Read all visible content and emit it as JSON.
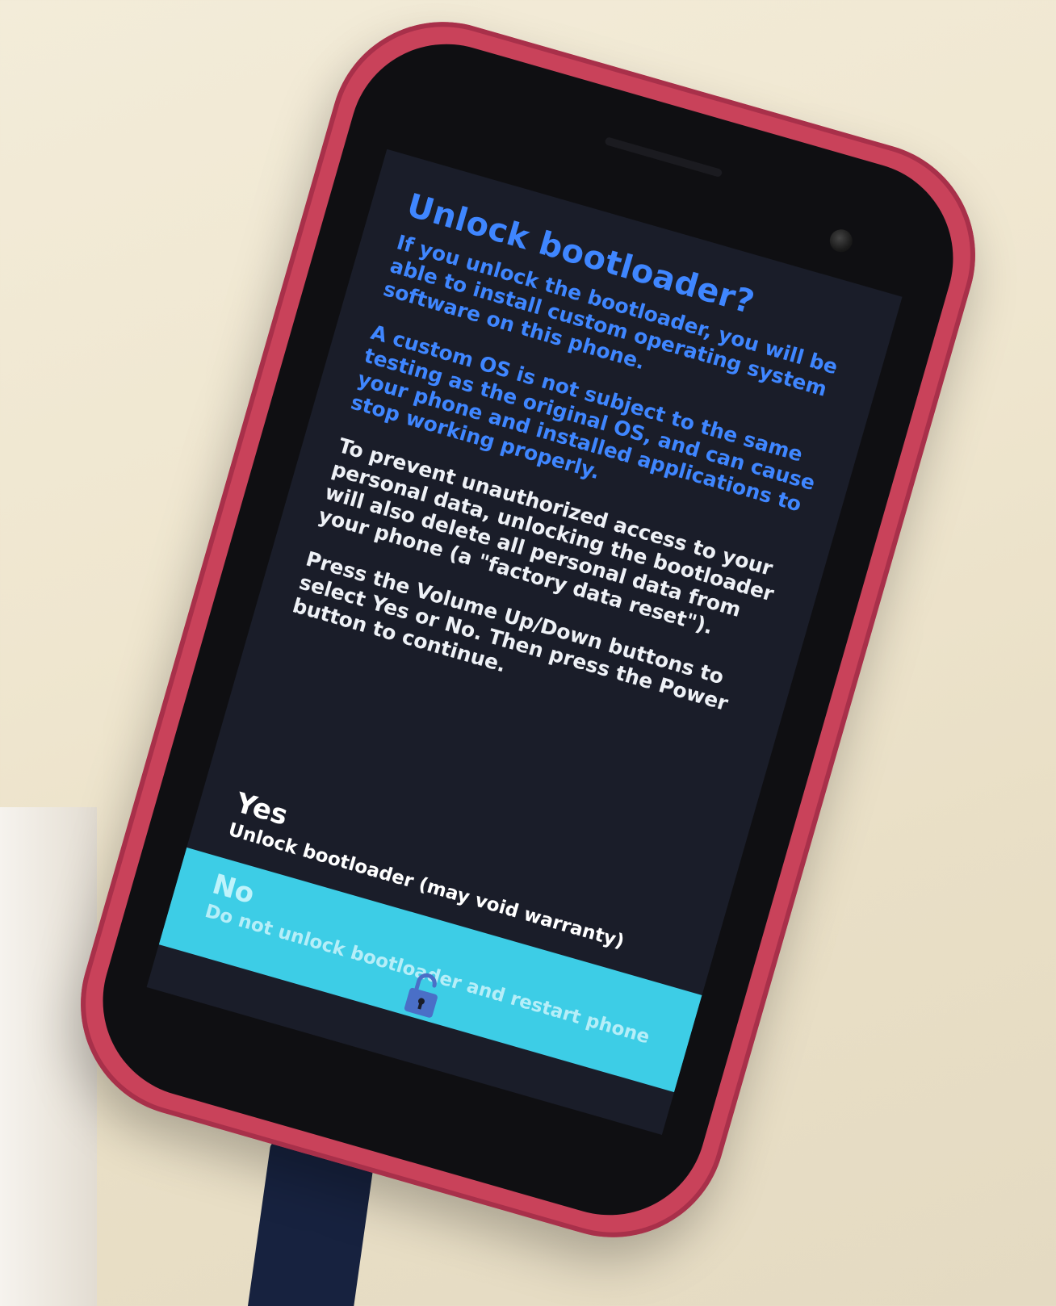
{
  "screen": {
    "title": "Unlock bootloader?",
    "paragraphs": [
      "If you unlock the bootloader, you will be able to install custom operating system software on this phone.",
      "A custom OS is not subject to the same testing as the original OS, and can cause your phone and installed applications to stop working properly.",
      "To prevent unauthorized access to your personal data, unlocking the bootloader will also delete all personal data from your phone (a \"factory data reset\").",
      "Press the Volume Up/Down buttons to select Yes or No. Then press the Power button to continue."
    ],
    "options": {
      "yes": {
        "title": "Yes",
        "description": "Unlock bootloader (may void warranty)",
        "selected": false
      },
      "no": {
        "title": "No",
        "description": "Do not unlock bootloader and restart phone",
        "selected": true
      }
    },
    "icons": {
      "bottom": "unlock-icon"
    }
  },
  "colors": {
    "title": "#3f86ff",
    "screen_background": "#1a1d29",
    "selection_highlight": "#3dcde6",
    "case": "#c9425a"
  }
}
